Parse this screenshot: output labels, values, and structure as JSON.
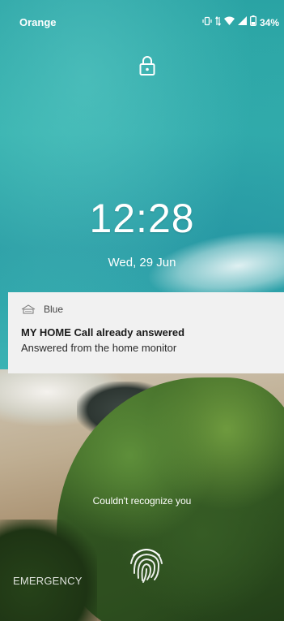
{
  "status_bar": {
    "carrier": "Orange",
    "battery_percent": "34%",
    "icons": [
      "vibrate-icon",
      "data-arrows-icon",
      "wifi-icon",
      "signal-icon",
      "battery-icon"
    ]
  },
  "lock": {
    "icon": "lock-icon"
  },
  "clock": {
    "time": "12:28",
    "date": "Wed, 29 Jun"
  },
  "notification": {
    "app_name": "Blue",
    "title": "MY HOME Call already answered",
    "body": "Answered from the home monitor"
  },
  "face_unlock": {
    "message": "Couldn't recognize you"
  },
  "emergency": {
    "label": "EMERGENCY"
  },
  "colors": {
    "notification_bg": "#f1f1f1",
    "text_light": "#ffffff"
  }
}
